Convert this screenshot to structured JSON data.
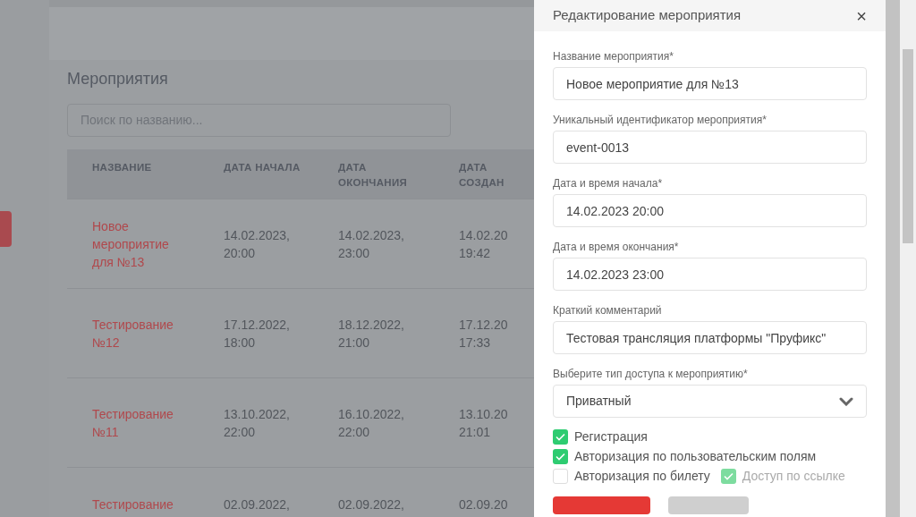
{
  "page": {
    "title": "Мероприятия",
    "search": {
      "placeholder": "Поиск по названию..."
    },
    "table": {
      "columns": [
        "НАЗВАНИЕ",
        "ДАТА НАЧАЛА",
        "ДАТА ОКОНЧАНИЯ",
        "ДАТА СОЗДАН"
      ],
      "rows": [
        {
          "name": "Новое мероприятие для №13",
          "start": "14.02.2023, 20:00",
          "end": "14.02.2023, 23:00",
          "created": "14.02.20 19:42"
        },
        {
          "name": "Тестирование №12",
          "start": "17.12.2022, 18:00",
          "end": "18.12.2022, 21:00",
          "created": "17.12.20 17:33"
        },
        {
          "name": "Тестирование №11",
          "start": "13.10.2022, 22:00",
          "end": "16.10.2022, 22:00",
          "created": "13.10.20 21:01"
        },
        {
          "name": "Тестирование",
          "start": "02.09.2022,",
          "end": "02.09.2022,",
          "created": "02.09.20"
        }
      ]
    }
  },
  "modal": {
    "title": "Редактирование мероприятия",
    "close": "×",
    "fields": [
      {
        "kind": "text",
        "label": "Название мероприятия*",
        "value": "Новое мероприятие для №13"
      },
      {
        "kind": "text",
        "label": "Уникальный идентификатор мероприятия*",
        "value": "event-0013"
      },
      {
        "kind": "text",
        "label": "Дата и время начала*",
        "value": "14.02.2023 20:00"
      },
      {
        "kind": "text",
        "label": "Дата и время окончания*",
        "value": "14.02.2023 23:00"
      },
      {
        "kind": "text",
        "label": "Краткий комментарий",
        "value": "Тестовая трансляция платформы \"Пруфикс\""
      },
      {
        "kind": "select",
        "label": "Выберите тип доступа к мероприятию*",
        "value": "Приватный"
      }
    ],
    "checkbox_rows": [
      [
        {
          "label": "Регистрация",
          "checked": true,
          "disabled": false
        }
      ],
      [
        {
          "label": "Авторизация по пользовательским полям",
          "checked": true,
          "disabled": false
        }
      ],
      [
        {
          "label": "Авторизация по билету",
          "checked": false,
          "disabled": false
        },
        {
          "label": "Доступ по ссылке",
          "checked": true,
          "disabled": true
        }
      ]
    ]
  }
}
